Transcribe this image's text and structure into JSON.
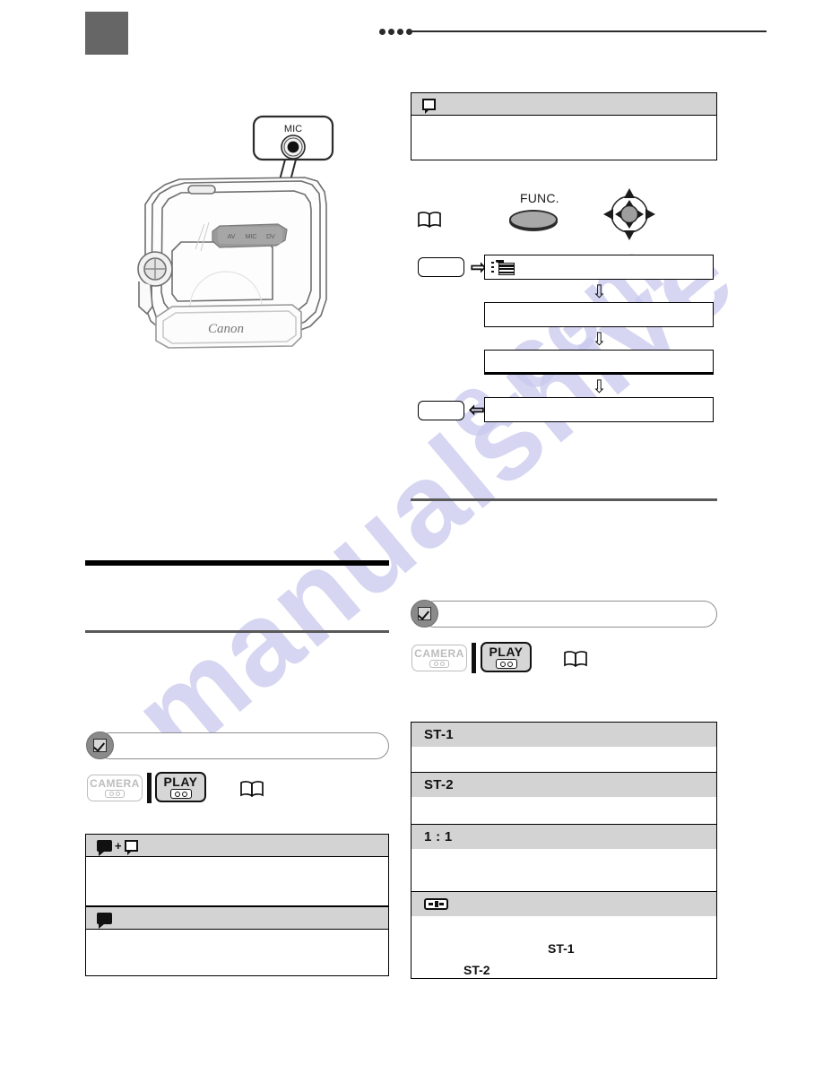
{
  "page": {
    "doc_kind": "camcorder-instruction-manual-page",
    "background_color": "#ffffff",
    "header": {
      "tab_marker_color": "#666666",
      "bullet_dots_count": 4,
      "dot_color": "#2b2b2b",
      "rule_color": "#2b2b2b"
    },
    "watermark": {
      "line1": "manualshive",
      "line2": "e.com",
      "color": "#c9c9ee"
    }
  },
  "illustration": {
    "name": "camcorder-rear-terminal-view",
    "callout_label": "MIC",
    "brand_text": "Canon",
    "terminal_labels": [
      "AV",
      "MIC",
      "DV"
    ],
    "terminal_strip_color": "#9a9a9a",
    "body_outline_color": "#6f6f6f"
  },
  "right_column": {
    "top_panel": {
      "header_icon": "screen-outline-icon",
      "header_label": "",
      "body_text": ""
    },
    "controls": {
      "book_ref_icon": "open-book-icon",
      "func_label": "FUNC.",
      "joystick_icon": "four-way-joystick-icon",
      "func_button_fill": "#a8a8a8"
    },
    "flow": {
      "start_button_label": "",
      "end_button_label": "",
      "arrow_right": "⇨",
      "arrow_left": "⇦",
      "arrow_down": "⇩",
      "rows": [
        {
          "icon": "menu-list-icon",
          "label": ""
        },
        {
          "icon": "",
          "label": ""
        },
        {
          "icon": "",
          "label": ""
        },
        {
          "icon": "",
          "label": ""
        }
      ]
    },
    "section_rule_color": "#595959",
    "notes": {
      "badge_icon": "check-mark-badge-icon",
      "text": ""
    },
    "modes": [
      {
        "label": "CAMERA",
        "icon": "tape-reels-icon",
        "state": "inactive"
      },
      {
        "label": "PLAY",
        "icon": "tape-reels-icon",
        "state": "active"
      }
    ],
    "mode_page_ref_icon": "open-book-icon",
    "option_table": {
      "sections": [
        {
          "icon": "",
          "label": "ST-1",
          "body": ""
        },
        {
          "icon": "",
          "label": "ST-2",
          "body": ""
        },
        {
          "icon": "",
          "label": "1 : 1",
          "body": ""
        },
        {
          "icon": "index-mark-icon",
          "label": "",
          "body": "",
          "inline_notes": [
            "ST-1",
            "ST-2"
          ]
        }
      ]
    }
  },
  "left_column": {
    "heading_rule_color": "#000000",
    "subheading_rule_color": "#595959",
    "heading_text": "",
    "body_text": "",
    "notes": {
      "badge_icon": "check-mark-badge-icon",
      "text": ""
    },
    "modes": [
      {
        "label": "CAMERA",
        "icon": "tape-reels-icon",
        "state": "inactive"
      },
      {
        "label": "PLAY",
        "icon": "tape-reels-icon",
        "state": "active"
      }
    ],
    "mode_page_ref_icon": "open-book-icon",
    "panels": [
      {
        "header_icons": [
          "balloon-solid-icon",
          "plus-sign",
          "screen-outline-icon"
        ],
        "label": "",
        "body": ""
      },
      {
        "header_icons": [
          "balloon-solid-icon"
        ],
        "label": "",
        "body": ""
      }
    ]
  }
}
